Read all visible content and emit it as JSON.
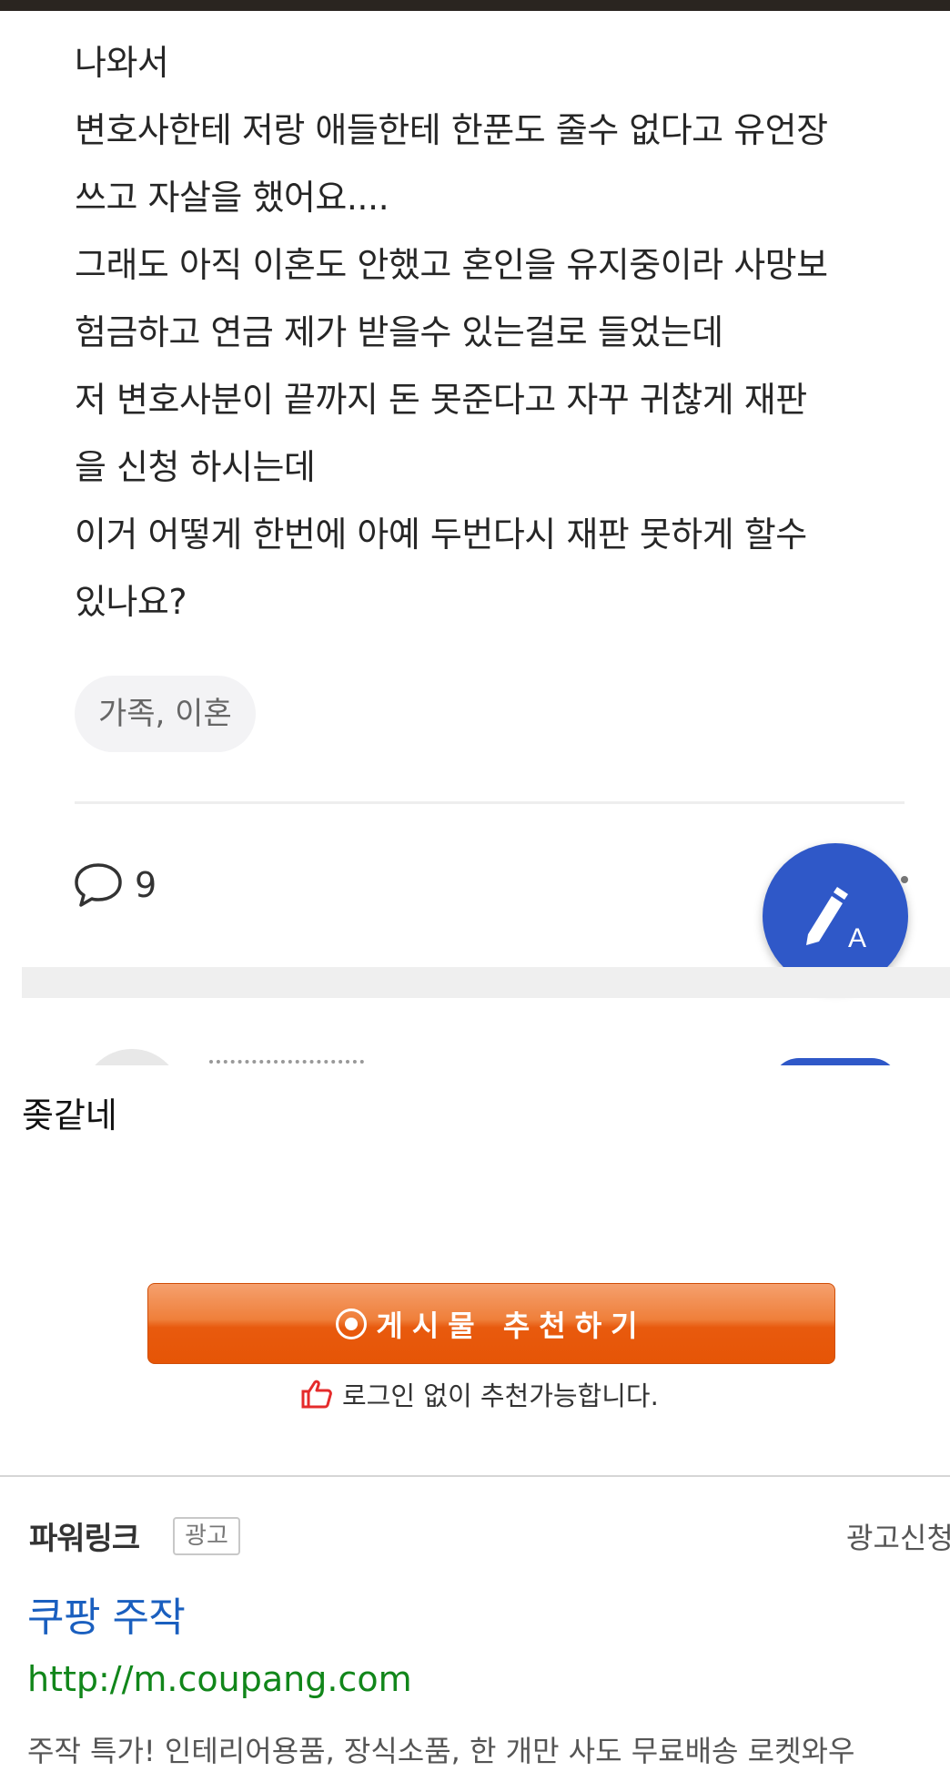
{
  "post": {
    "lines": [
      "나와서",
      "변호사한테 저랑 애들한테 한푼도 줄수 없다고 유언장",
      "쓰고 자살을 했어요....",
      "그래도 아직 이혼도 안했고 혼인을 유지중이라 사망보",
      "험금하고 연금 제가 받을수 있는걸로 들었는데",
      "저 변호사분이 끝까지 돈 못준다고 자꾸 귀찮게 재판",
      "을 신청 하시는데",
      "이거 어떻게 한번에 아예 두번다시 재판 못하게 할수",
      "있나요?"
    ],
    "tag": "가족, 이혼",
    "comment_count": "9"
  },
  "caption": "좆같네",
  "recommend": {
    "button_label": "게시물 추천하기",
    "note": "로그인 없이 추천가능합니다."
  },
  "ad": {
    "section_label": "파워링크",
    "badge": "광고",
    "apply_label": "광고신청",
    "title": "쿠팡 주작",
    "url": "http://m.coupang.com",
    "description": "주작 특가! 인테리어용품, 장식소품, 한 개만 사도 무료배송 로켓와우"
  },
  "icons": {
    "comment": "speech-bubble-icon",
    "fab": "pencil-write-icon",
    "recommend": "target-circle-icon",
    "thumbs": "thumbs-up-icon"
  },
  "colors": {
    "fab": "#2f58c8",
    "recommend_button": "#e65506",
    "ad_title": "#1a5fbf",
    "ad_url": "#11861a"
  }
}
